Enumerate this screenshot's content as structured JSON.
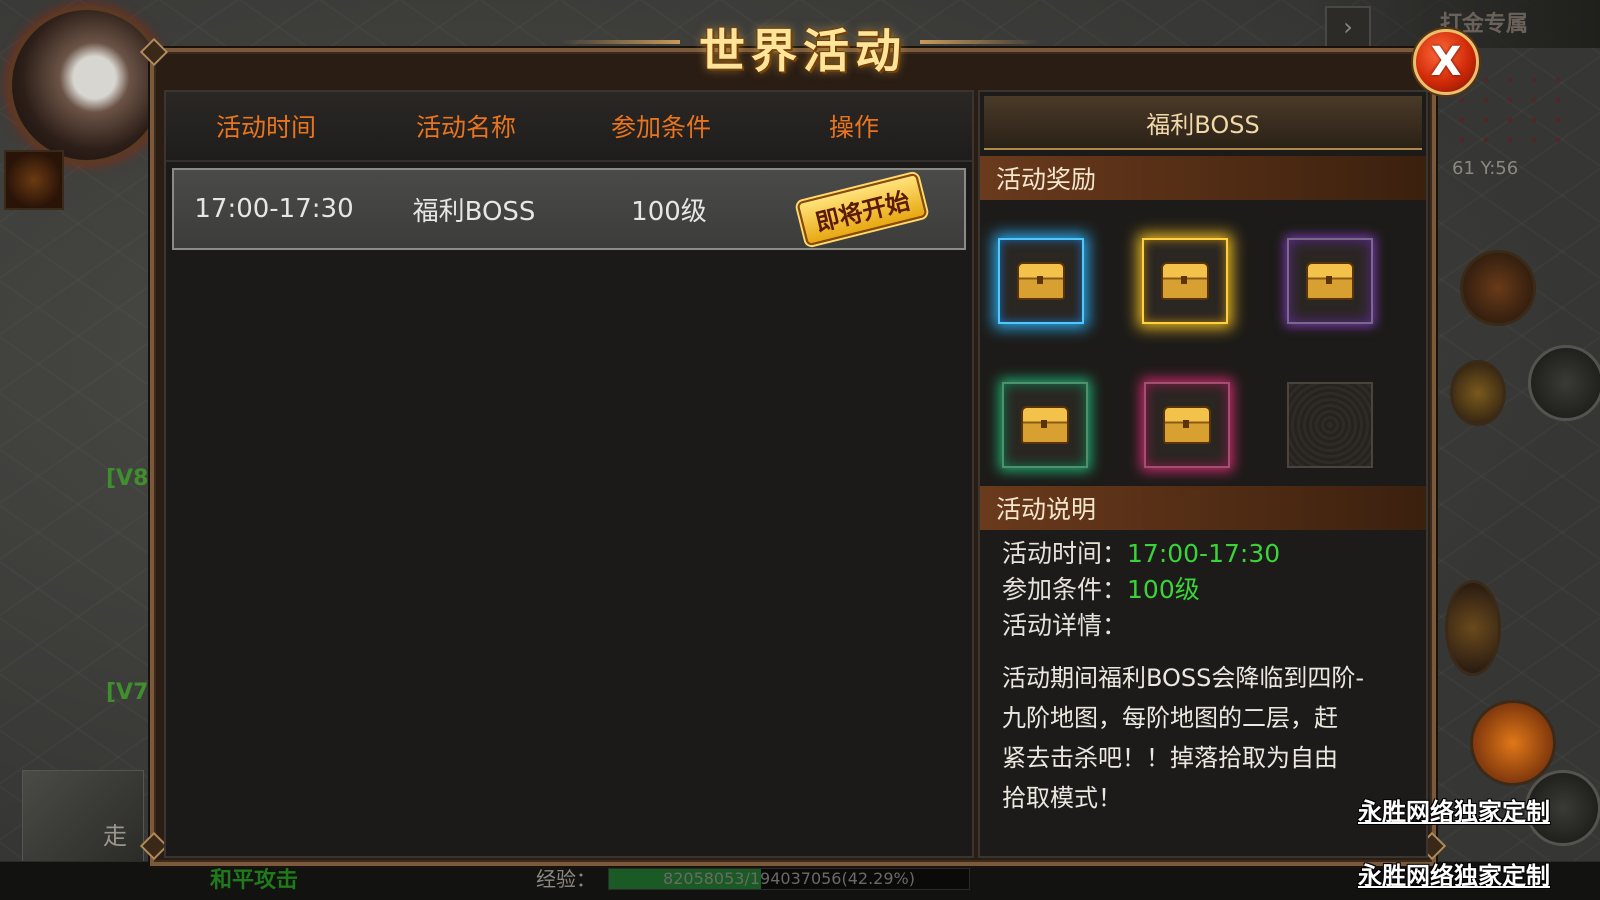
{
  "background": {
    "top_right_label": "打金专属",
    "coords": "61  Y:56",
    "v_tags": [
      "[V8]",
      "[V7]"
    ],
    "walk_label": "走",
    "attack_mode": "和平攻击",
    "exp_label": "经验：",
    "exp_text": "82058053/194037056(42.29%)",
    "exp_percent": 42.29
  },
  "dialog": {
    "title": "世界活动",
    "close_label": "X"
  },
  "activity_table": {
    "headers": [
      "活动时间",
      "活动名称",
      "参加条件",
      "操作"
    ],
    "rows": [
      {
        "time": "17:00-17:30",
        "name": "福利BOSS",
        "condition": "100级",
        "action": "即将开始"
      }
    ]
  },
  "detail": {
    "title": "福利BOSS",
    "reward_section": "活动奖励",
    "rewards": [
      {
        "icon": "blue-chest-icon",
        "color": "#2aa8e8"
      },
      {
        "icon": "gold-chest-icon",
        "color": "#e8b820"
      },
      {
        "icon": "purple-chest-icon",
        "color": "#7a3ab0"
      },
      {
        "icon": "green-chest-icon",
        "color": "#20a870"
      },
      {
        "icon": "pink-chest-icon",
        "color": "#c82a6a"
      },
      {
        "icon": "empty-slot",
        "color": "#2e2b27"
      }
    ],
    "desc_section": "活动说明",
    "time_label": "活动时间：",
    "time_value": "17:00-17:30",
    "cond_label": "参加条件：",
    "cond_value": "100级",
    "detail_label": "活动详情：",
    "detail_lines": [
      "活动期间福利BOSS会降临到四阶-",
      "九阶地图，每阶地图的二层，赶",
      "紧去击杀吧！！掉落拾取为自由",
      "拾取模式！"
    ]
  },
  "watermark": {
    "line1": "永胜网络独家定制",
    "line2": "永胜网络独家定制"
  },
  "colors": {
    "header_orange": "#e8741e",
    "value_green": "#3ad43a",
    "title_gold": "#ffe59a"
  }
}
